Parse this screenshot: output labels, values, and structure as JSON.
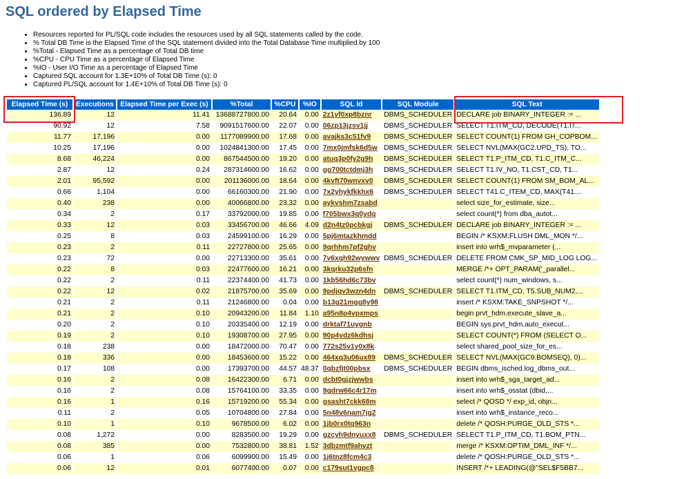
{
  "title": "SQL ordered by Elapsed Time",
  "notes": [
    "Resources reported for PL/SQL code includes the resources used by all SQL statements called by the code.",
    "% Total DB Time is the Elapsed Time of the SQL statement divided into the Total Database Time multiplied by 100",
    "%Total - Elapsed Time as a percentage of Total DB time",
    "%CPU - CPU Time as a percentage of Elapsed Time",
    "%IO - User I/O Time as a percentage of Elapsed Time",
    "Captured SQL account for 1.3E+10% of Total DB Time (s): 0",
    "Captured PL/SQL account for 1.4E+10% of Total DB Time (s): 0"
  ],
  "columns": [
    "Elapsed Time (s)",
    "Executions",
    "Elapsed Time per Exec (s)",
    "%Total",
    "%CPU",
    "%IO",
    "SQL Id",
    "SQL Module",
    "SQL Text"
  ],
  "rows": [
    [
      "136.89",
      "12",
      "11.41",
      "13688727800.00",
      "20.64",
      "0.00",
      "2z1yf0xp8bznr",
      "DBMS_SCHEDULER",
      "DECLARE job BINARY_INTEGER := ..."
    ],
    [
      "90.92",
      "12",
      "7.58",
      "9091517600.00",
      "22.07",
      "0.00",
      "06zp13jzsv1jj",
      "DBMS_SCHEDULER",
      "SELECT T1.ITM_CD, DECODE(T1.IT..."
    ],
    [
      "11.77",
      "17,196",
      "0.00",
      "1177089900.00",
      "17.68",
      "0.00",
      "avajks3c51fv9",
      "DBMS_SCHEDULER",
      "SELECT COUNT(1) FROM GH_COPBOM..."
    ],
    [
      "10.25",
      "17,196",
      "0.00",
      "1024841300.00",
      "17.45",
      "0.00",
      "7mx0jmfsk6d5w",
      "DBMS_SCHEDULER",
      "SELECT NVL(MAX(GC2.UPD_TS), TO..."
    ],
    [
      "8.68",
      "46,224",
      "0.00",
      "867544500.00",
      "19.20",
      "0.00",
      "atuq3p0fy2g9h",
      "DBMS_SCHEDULER",
      "SELECT T1.P_ITM_CD, T1.C_ITM_C..."
    ],
    [
      "2.87",
      "12",
      "0.24",
      "287314600.00",
      "16.62",
      "0.00",
      "gg700tctdmj3h",
      "DBMS_SCHEDULER",
      "SELECT T1.IV_NO, T1.CST_CD, T1..."
    ],
    [
      "2.01",
      "95,592",
      "0.00",
      "201136000.00",
      "18.64",
      "0.00",
      "4kvft70wnvxv0",
      "DBMS_SCHEDULER",
      "SELECT COUNT(1) FROM SM_BOM_AL..."
    ],
    [
      "0.66",
      "1,104",
      "0.00",
      "66160300.00",
      "21.90",
      "0.00",
      "7x2yhykfkkhx6",
      "DBMS_SCHEDULER",
      "SELECT T41.C_ITEM_CD, MAX(T41...."
    ],
    [
      "0.40",
      "238",
      "0.00",
      "40066800.00",
      "23.32",
      "0.00",
      "aykvshm7zsabd",
      "",
      "select size_for_estimate, size..."
    ],
    [
      "0.34",
      "2",
      "0.17",
      "33792000.00",
      "19.85",
      "0.00",
      "f705bwx3q0ydq",
      "",
      "select count(*) from dba_autot..."
    ],
    [
      "0.33",
      "12",
      "0.03",
      "33456700.00",
      "46.66",
      "4.09",
      "d2n4tz0pcbkgj",
      "DBMS_SCHEDULER",
      "DECLARE job BINARY_INTEGER := ..."
    ],
    [
      "0.25",
      "8",
      "0.03",
      "24599100.00",
      "16.29",
      "0.00",
      "5pj6mtazkhmdd",
      "",
      "BEGIN /* KSXM:FLUSH DML_MON */..."
    ],
    [
      "0.23",
      "2",
      "0.11",
      "22727800.00",
      "25.65",
      "0.00",
      "9qrhhm7pf2ghv",
      "",
      "insert into wrh$_mvparameter (..."
    ],
    [
      "0.23",
      "72",
      "0.00",
      "22713300.00",
      "35.61",
      "0.00",
      "7v6xqh92wywwv",
      "DBMS_SCHEDULER",
      "DELETE FROM CMK_SP_MID_LOG LOG..."
    ],
    [
      "0.22",
      "8",
      "0.03",
      "22477600.00",
      "16.21",
      "0.00",
      "3kqrku32p6sfn",
      "",
      "MERGE /*+ OPT_PARAM('_parallel..."
    ],
    [
      "0.22",
      "2",
      "0.11",
      "22374400.00",
      "41.73",
      "0.00",
      "1kb56hd6c73bv",
      "",
      "select count(*) num_windows, s..."
    ],
    [
      "0.22",
      "12",
      "0.02",
      "21875700.00",
      "35.69",
      "0.00",
      "9pdjqv3wzn4dn",
      "DBMS_SCHEDULER",
      "SELECT T1.ITM_CD, T5.SUB_NUM2,..."
    ],
    [
      "0.21",
      "2",
      "0.11",
      "21246800.00",
      "0.04",
      "0.00",
      "b13g21mgg8y98",
      "",
      "insert /* KSXM:TAKE_SNPSHOT */..."
    ],
    [
      "0.21",
      "2",
      "0.10",
      "20943200.00",
      "11.84",
      "1.10",
      "a95n8p4vpxmps",
      "",
      "begin prvt_hdm.execute_slave_a..."
    ],
    [
      "0.20",
      "2",
      "0.10",
      "20335400.00",
      "12.19",
      "0.00",
      "drktaf71uygnb",
      "",
      "BEGIN sys.prvt_hdm.auto_execut..."
    ],
    [
      "0.19",
      "2",
      "0.10",
      "19308700.00",
      "27.95",
      "0.00",
      "90p4ydz6kdhsj",
      "",
      "SELECT COUNT(*) FROM (SELECT O..."
    ],
    [
      "0.18",
      "238",
      "0.00",
      "18472000.00",
      "70.47",
      "0.00",
      "772s25v1y0x8k",
      "",
      "select shared_pool_size_for_es..."
    ],
    [
      "0.18",
      "336",
      "0.00",
      "18453600.00",
      "15.22",
      "0.00",
      "464xq3u06ux89",
      "DBMS_SCHEDULER",
      "SELECT NVL(MAX(GC9.BOMSEQ), 0)..."
    ],
    [
      "0.17",
      "108",
      "0.00",
      "17393700.00",
      "44.57",
      "48.37",
      "0qbzfjt00pbsx",
      "DBMS_SCHEDULER",
      "BEGIN dbms_isched.log_dbms_out..."
    ],
    [
      "0.16",
      "2",
      "0.08",
      "16422300.00",
      "6.71",
      "0.00",
      "dcbt0gjzjwwbs",
      "",
      "insert into wrh$_sga_target_ad..."
    ],
    [
      "0.16",
      "2",
      "0.08",
      "15764100.00",
      "33.35",
      "0.00",
      "9gdrw66c4r17m",
      "",
      "insert into wrh$_osstat (dbid,..."
    ],
    [
      "0.16",
      "1",
      "0.16",
      "15719200.00",
      "55.34",
      "0.00",
      "gsasht7ckk68m",
      "",
      "select /* QOSD */ exp_id, objn..."
    ],
    [
      "0.11",
      "2",
      "0.05",
      "10704800.00",
      "27.84",
      "0.00",
      "5n48v6nam7jg2",
      "",
      "insert into wrh$_instance_reco..."
    ],
    [
      "0.10",
      "1",
      "0.10",
      "9678500.00",
      "6.02",
      "0.00",
      "1jb0rx0tq963n",
      "",
      "delete /* QOSH:PURGE_OLD_STS *..."
    ],
    [
      "0.08",
      "1,272",
      "0.00",
      "8283500.00",
      "19.29",
      "0.00",
      "gzcyh9dnyuxx8",
      "DBMS_SCHEDULER",
      "SELECT T1.P_ITM_CD, T1.BOM_PTN..."
    ],
    [
      "0.08",
      "385",
      "0.00",
      "7532800.00",
      "38.81",
      "1.52",
      "3dbzmtf9ahvzt",
      "",
      "merge /* KSXM:OPTIM_DML_INF */..."
    ],
    [
      "0.06",
      "1",
      "0.06",
      "6099900.00",
      "15.49",
      "0.00",
      "1j6tnz8fcm4c3",
      "",
      "delete /* QOSH:PURGE_OLD_STS *..."
    ],
    [
      "0.06",
      "12",
      "0.01",
      "6077400.00",
      "0.07",
      "0.00",
      "c179sut1vgpc8",
      "",
      "INSERT /*+ LEADING(@\"SEL$F5BB7..."
    ]
  ],
  "colors": {
    "title": "#336699",
    "header_bg": "#0066cc",
    "odd_row_bg": "#ffffcc",
    "sql_id_link": "#663300",
    "highlight_box": "#e01b24"
  }
}
